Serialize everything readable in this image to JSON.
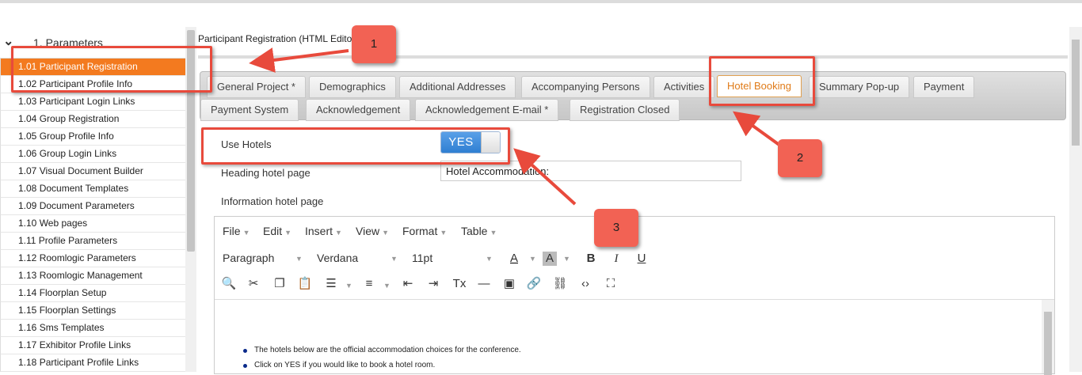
{
  "sidebar": {
    "title": "1. Parameters",
    "items": [
      {
        "label": "1.01 Participant Registration",
        "active": true
      },
      {
        "label": "1.02 Participant Profile Info"
      },
      {
        "label": "1.03 Participant Login Links"
      },
      {
        "label": "1.04 Group Registration"
      },
      {
        "label": "1.05 Group Profile Info"
      },
      {
        "label": "1.06 Group Login Links"
      },
      {
        "label": "1.07 Visual Document Builder"
      },
      {
        "label": "1.08 Document Templates"
      },
      {
        "label": "1.09 Document Parameters"
      },
      {
        "label": "1.10 Web pages"
      },
      {
        "label": "1.11 Profile Parameters"
      },
      {
        "label": "1.12 Roomlogic Parameters"
      },
      {
        "label": "1.13 Roomlogic Management"
      },
      {
        "label": "1.14 Floorplan Setup"
      },
      {
        "label": "1.15 Floorplan Settings"
      },
      {
        "label": "1.16 Sms Templates"
      },
      {
        "label": "1.17 Exhibitor Profile Links"
      },
      {
        "label": "1.18 Participant Profile Links"
      }
    ]
  },
  "main": {
    "title": "Participant Registration (HTML Edito",
    "tabs_row1": [
      "General Project *",
      "Demographics",
      "Additional Addresses",
      "Accompanying Persons",
      "Activities",
      "Hotel Booking",
      "Summary Pop-up",
      "Payment"
    ],
    "tabs_row2": [
      "Payment System",
      "Acknowledgement",
      "Acknowledgement E-mail *",
      "Registration Closed"
    ],
    "active_tab": "Hotel Booking",
    "use_hotels_label": "Use Hotels",
    "use_hotels_value": "YES",
    "heading_label": "Heading hotel page",
    "heading_value": "Hotel Accommodation:",
    "info_label": "Information hotel page"
  },
  "editor": {
    "menu": [
      "File",
      "Edit",
      "Insert",
      "View",
      "Format",
      "Table"
    ],
    "block_format": "Paragraph",
    "font_family": "Verdana",
    "font_size": "11pt",
    "bullets": [
      "The hotels below are the official accommodation choices for the conference.",
      "Click on YES if you would like to book a hotel room."
    ]
  },
  "annotations": {
    "callouts": [
      "1",
      "2",
      "3"
    ],
    "color": "#e84a3c"
  },
  "colors": {
    "active_sidebar": "#f37a1f",
    "active_tab_text": "#e07b18",
    "toggle_blue": "#2f7fd2"
  }
}
